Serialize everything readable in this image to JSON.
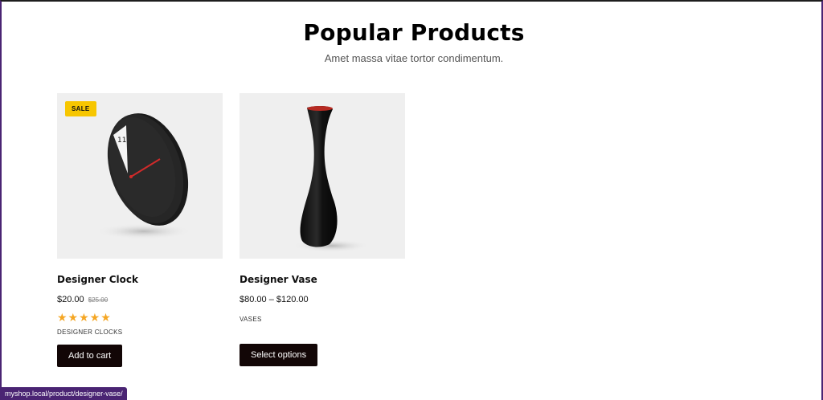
{
  "section": {
    "title": "Popular Products",
    "subtitle": "Amet massa vitae tortor condimentum."
  },
  "products": [
    {
      "name": "Designer Clock",
      "badge": "SALE",
      "price": "$20.00",
      "old_price": "$25.00",
      "rating": 5,
      "stars": "★★★★★",
      "category": "DESIGNER CLOCKS",
      "button": "Add to cart",
      "image_icon": "wall-clock-icon"
    },
    {
      "name": "Designer Vase",
      "price": "$80.00 – $120.00",
      "category": "VASES",
      "button": "Select options",
      "image_icon": "vase-icon"
    }
  ],
  "status_bar": {
    "url": "myshop.local/product/designer-vase/"
  },
  "colors": {
    "sale_badge": "#f7c600",
    "stars": "#f5a623",
    "button_bg": "#120606",
    "status_bar_bg": "#4a2473",
    "thumb_bg": "#efefef"
  }
}
